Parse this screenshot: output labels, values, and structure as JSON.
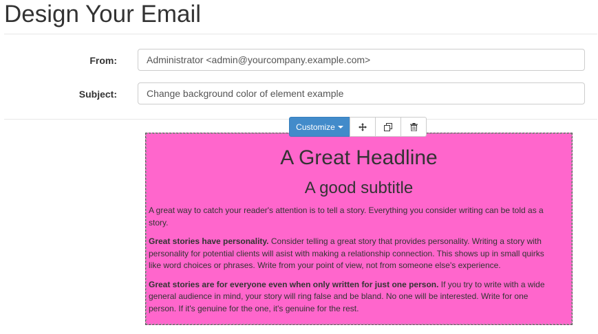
{
  "header": {
    "title": "Design Your Email"
  },
  "form": {
    "from_label": "From:",
    "from_value": "Administrator <admin@yourcompany.example.com>",
    "subject_label": "Subject:",
    "subject_value": "Change background color of element example"
  },
  "toolbar": {
    "customize_label": "Customize",
    "icons": [
      "move-icon",
      "duplicate-icon",
      "trash-icon"
    ]
  },
  "email": {
    "background_color": "#ff66cc",
    "headline": "A Great Headline",
    "subtitle": "A good subtitle",
    "paragraph1": "A great way to catch your reader's attention is to tell a story. Everything you consider writing can be told as a story.",
    "paragraph2_bold": "Great stories have personality.",
    "paragraph2_rest": " Consider telling a great story that provides personality. Writing a story with personality for potential clients will asist with making a relationship connection. This shows up in small quirks like word choices or phrases. Write from your point of view, not from someone else's experience.",
    "paragraph3_bold": "Great stories are for everyone even when only written for just one person.",
    "paragraph3_rest": " If you try to write with a wide general audience in mind, your story will ring false and be bland. No one will be interested. Write for one person. If it's genuine for the one, it's genuine for the rest."
  },
  "colors": {
    "accent": "#428bca"
  }
}
